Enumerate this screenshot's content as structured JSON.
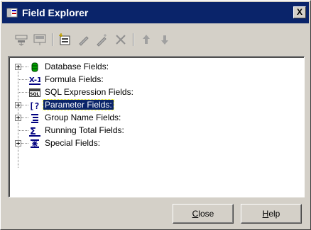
{
  "window": {
    "title": "Field Explorer",
    "close_glyph": "X"
  },
  "toolbar": {
    "buttons": [
      {
        "name": "insert-to-report-icon"
      },
      {
        "name": "browse-icon"
      },
      {
        "name": "new-icon"
      },
      {
        "name": "edit-icon"
      },
      {
        "name": "rename-icon"
      },
      {
        "name": "delete-icon"
      },
      {
        "name": "move-up-icon"
      },
      {
        "name": "move-down-icon"
      }
    ]
  },
  "tree": {
    "items": [
      {
        "label": "Database Fields:",
        "expandable": true,
        "icon": "database-icon"
      },
      {
        "label": "Formula Fields:",
        "expandable": false,
        "icon": "formula-icon"
      },
      {
        "label": "SQL Expression Fields:",
        "expandable": false,
        "icon": "sql-icon"
      },
      {
        "label": "Parameter Fields:",
        "expandable": true,
        "icon": "parameter-icon",
        "selected": true
      },
      {
        "label": "Group Name Fields:",
        "expandable": true,
        "icon": "group-name-icon"
      },
      {
        "label": "Running Total Fields:",
        "expandable": false,
        "icon": "running-total-icon"
      },
      {
        "label": "Special Fields:",
        "expandable": true,
        "icon": "special-fields-icon"
      }
    ]
  },
  "buttons": {
    "close_mnemonic": "C",
    "close_rest": "lose",
    "help_mnemonic": "H",
    "help_rest": "elp"
  }
}
